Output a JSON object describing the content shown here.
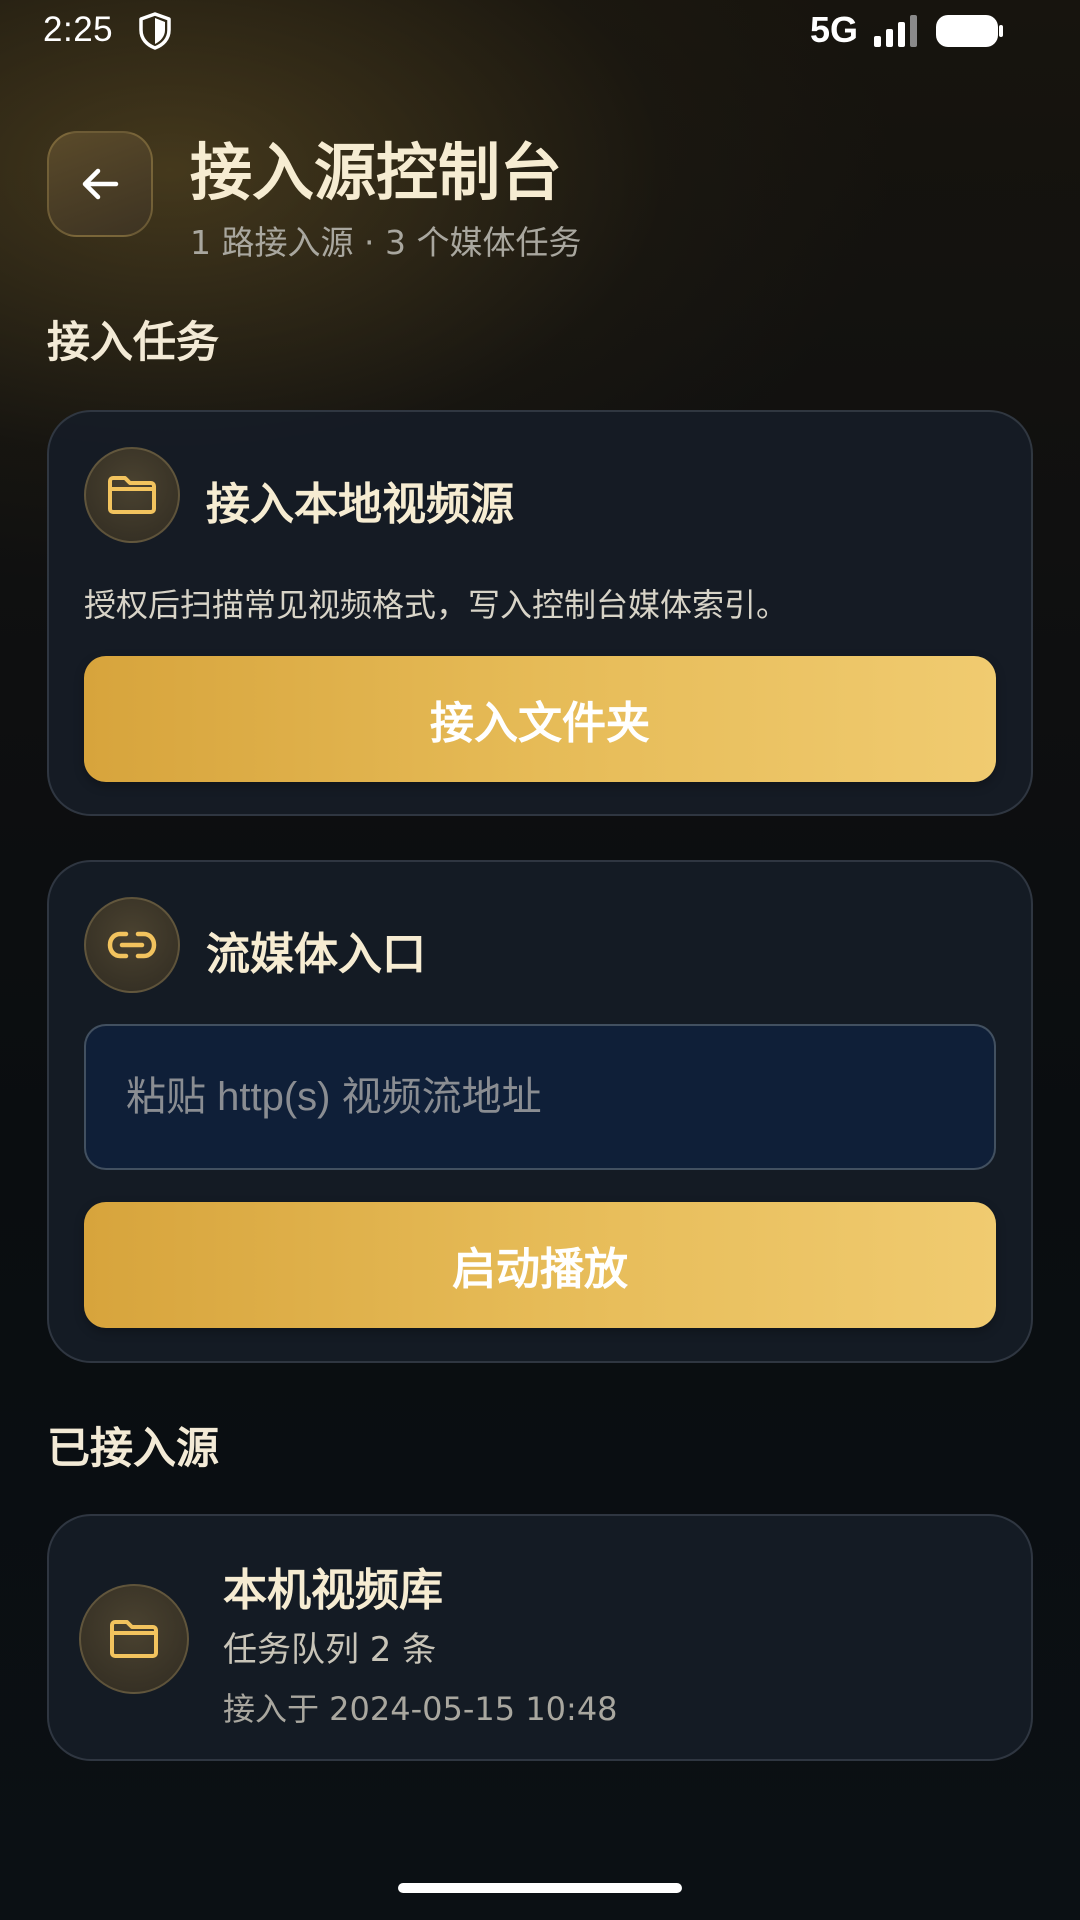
{
  "status_bar": {
    "time": "2:25",
    "network": "5G",
    "shield_icon": "shield-icon",
    "signal_icon": "signal-icon",
    "battery_icon": "battery-icon"
  },
  "header": {
    "back_icon": "arrow-left-icon",
    "title": "接入源控制台",
    "subtitle": "1 路接入源 · 3 个媒体任务"
  },
  "tasks_section": {
    "title": "接入任务",
    "local_card": {
      "icon": "folder-icon",
      "title": "接入本地视频源",
      "description": "授权后扫描常见视频格式，写入控制台媒体索引。",
      "button_label": "接入文件夹"
    },
    "stream_card": {
      "icon": "link-icon",
      "title": "流媒体入口",
      "input_value": "",
      "input_placeholder": "粘贴 http(s) 视频流地址",
      "button_label": "启动播放"
    }
  },
  "sources_section": {
    "title": "已接入源",
    "items": [
      {
        "icon": "folder-icon",
        "name": "本机视频库",
        "queue": "任务队列 2 条",
        "connected_at": "接入于 2024-05-15 10:48"
      }
    ]
  },
  "colors": {
    "accent_gold": "#E6BB57",
    "icon_gold": "#F2C35E",
    "card_bg": "#161C26",
    "input_bg": "#0F1F38"
  }
}
